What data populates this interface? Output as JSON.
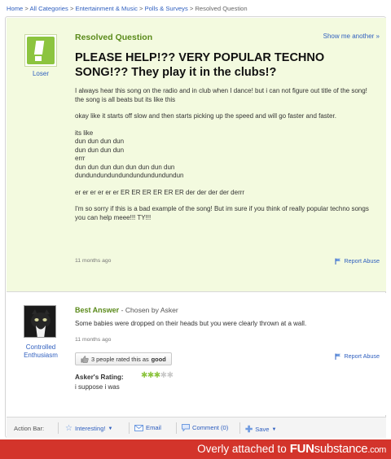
{
  "breadcrumb": {
    "items": [
      "Home",
      "All Categories",
      "Entertainment & Music",
      "Polls & Surveys"
    ],
    "current": "Resolved Question",
    "separator": ">"
  },
  "question": {
    "status": "Resolved Question",
    "show_me_another": "Show me another »",
    "asker_name": "Loser",
    "title": "PLEASE HELP!?? VERY POPULAR TECHNO SONG!?? They play it in the clubs!?",
    "paragraph1": "I always hear this song on the radio and in club when I dance! but i can not figure out title of the song! the song is all beats but its like this",
    "paragraph2": "okay like it starts off slow and then starts picking up the speed and will go faster and faster.",
    "lines": [
      "its like",
      "dun dun dun dun",
      "dun dun dun dun",
      "errr",
      "dun dun dun dun dun dun dun dun",
      "dundundundundundundundundundun"
    ],
    "paragraph3": "er er er er er er ER ER ER ER ER ER der der der der derrr",
    "paragraph4": "I'm so sorry if this is a bad example of the song! But im sure if you think of really popular techno songs you can help meee!!! TY!!!",
    "time": "11 months ago",
    "report": "Report Abuse"
  },
  "answer": {
    "label": "Best Answer",
    "chosen_by": " - Chosen by Asker",
    "answerer_name": "Controlled Enthusiasm",
    "text": "Some babies were dropped on their heads but you were clearly thrown at a wall.",
    "time": "11 months ago",
    "report": "Report Abuse",
    "rated_prefix": "3 people rated this as",
    "rated_value": "good",
    "rating_label": "Asker's Rating:",
    "rating_stars": 3,
    "rating_max": 5,
    "comment": "i suppose i was"
  },
  "action_bar": {
    "label": "Action Bar:",
    "interesting": "Interesting!",
    "email": "Email",
    "comment": "Comment (0)",
    "save": "Save"
  },
  "banner": {
    "prefix": "Overly attached to",
    "brand_main": "FUN",
    "brand_sub": "substance",
    "brand_suffix": ".com"
  },
  "colors": {
    "accent_green": "#5a8a1a",
    "link_blue": "#2f5fbf",
    "banner_red": "#d3342b",
    "question_bg": "#f3fadf"
  }
}
